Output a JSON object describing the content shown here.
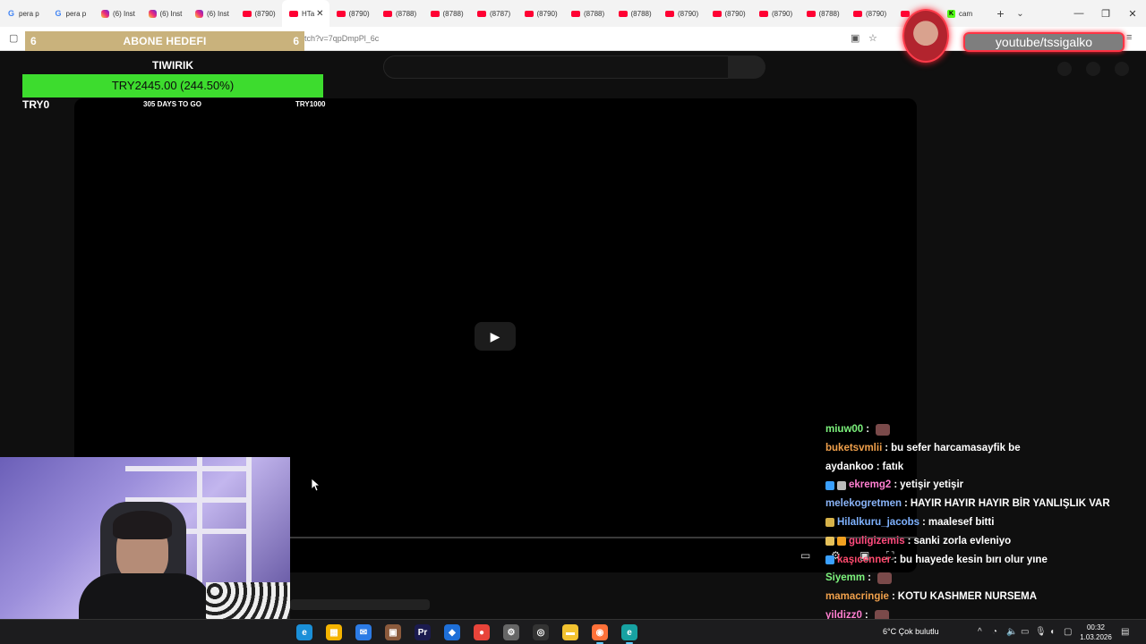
{
  "browser": {
    "tabs": [
      {
        "label": "pera p",
        "favicon": "google-icon"
      },
      {
        "label": "pera p",
        "favicon": "google-icon"
      },
      {
        "label": "(6) Inst",
        "favicon": "instagram-icon"
      },
      {
        "label": "(6) Inst",
        "favicon": "instagram-icon"
      },
      {
        "label": "(6) Inst",
        "favicon": "instagram-icon"
      },
      {
        "label": "(8790)",
        "favicon": "youtube-icon"
      },
      {
        "label": "HTa",
        "favicon": "youtube-icon",
        "active": true
      },
      {
        "label": "(8790)",
        "favicon": "youtube-icon"
      },
      {
        "label": "(8788)",
        "favicon": "youtube-icon"
      },
      {
        "label": "(8788)",
        "favicon": "youtube-icon"
      },
      {
        "label": "(8787)",
        "favicon": "youtube-icon"
      },
      {
        "label": "(8790)",
        "favicon": "youtube-icon"
      },
      {
        "label": "(8788)",
        "favicon": "youtube-icon"
      },
      {
        "label": "(8788)",
        "favicon": "youtube-icon"
      },
      {
        "label": "(8790)",
        "favicon": "youtube-icon"
      },
      {
        "label": "(8790)",
        "favicon": "youtube-icon"
      },
      {
        "label": "(8790)",
        "favicon": "youtube-icon"
      },
      {
        "label": "(8788)",
        "favicon": "youtube-icon"
      },
      {
        "label": "(8790)",
        "favicon": "youtube-icon"
      },
      {
        "label": "",
        "favicon": "youtube-icon"
      },
      {
        "label": "cam",
        "favicon": "kick-icon"
      }
    ],
    "url": "tch?v=7qpDmpPl_6c",
    "new_tab": "+",
    "tab_list": "⌄",
    "close_tab": "✕"
  },
  "overlay": {
    "sub_goal": {
      "title": "ABONE HEDEFI",
      "current": "6",
      "target": "6"
    },
    "donation": {
      "title": "TIWIRIK",
      "value_text": "TRY2445.00 (244.50%)",
      "progress": 1.0,
      "min_label": "TRY0",
      "days_label": "305 DAYS TO GO",
      "max_label": "TRY1000"
    },
    "youtube_handle": "youtube/tssigalko"
  },
  "chat": [
    {
      "user": "miuw00",
      "color": "#7cf27c",
      "message": "",
      "badges": [],
      "emote": true
    },
    {
      "user": "buketsvmlii",
      "color": "#f0a04b",
      "message": "bu sefer harcamasayfik be",
      "badges": []
    },
    {
      "user": "aydankoo",
      "color": "#ffffff",
      "message": "fatık",
      "badges": []
    },
    {
      "user": "ekremg2",
      "color": "#ff7fd0",
      "message": "yetişir yetişir",
      "badges": [
        "#3aa0ff",
        "#bbbbbb"
      ]
    },
    {
      "user": "melekogretmen",
      "color": "#8ab4f8",
      "message": "HAYIR HAYIR HAYIR BİR YANLIŞLIK VAR",
      "badges": []
    },
    {
      "user": "Hilalkuru_jacobs",
      "color": "#7fb2ff",
      "message": "maalesef bitti",
      "badges": [
        "#d6b24a"
      ]
    },
    {
      "user": "guligizemis",
      "color": "#ff4b7d",
      "message": "sanki zorla evleniyo",
      "badges": [
        "#e6c15a",
        "#f0a020"
      ]
    },
    {
      "user": "kaşıcenner",
      "color": "#ff4b6e",
      "message": "bu hıayede kesin bırı olur yıne",
      "badges": [
        "#3aa0ff"
      ]
    },
    {
      "user": "Siyemm",
      "color": "#7cf27c",
      "message": "",
      "badges": [],
      "emote": true
    },
    {
      "user": "mamacringie",
      "color": "#f0a04b",
      "message": "KOTU KASHMER NURSEMA",
      "badges": []
    },
    {
      "user": "yildizz0",
      "color": "#ff7fd0",
      "message": "",
      "badges": [],
      "emote": true
    }
  ],
  "taskbar": {
    "apps": [
      {
        "name": "edge-icon",
        "color": "#1a8fd8",
        "glyph": "e"
      },
      {
        "name": "store-icon",
        "color": "#f5b400",
        "glyph": "▦"
      },
      {
        "name": "mail-icon",
        "color": "#2c7be5",
        "glyph": "✉"
      },
      {
        "name": "minecraft-icon",
        "color": "#8b5a3c",
        "glyph": "▣"
      },
      {
        "name": "premiere-icon",
        "color": "#1b1b4f",
        "glyph": "Pr"
      },
      {
        "name": "app-blue-icon",
        "color": "#1e6fd8",
        "glyph": "◆"
      },
      {
        "name": "chrome-icon",
        "color": "#e8443a",
        "glyph": "●"
      },
      {
        "name": "settings-icon",
        "color": "#666666",
        "glyph": "⚙"
      },
      {
        "name": "obs-icon",
        "color": "#333333",
        "glyph": "◎"
      },
      {
        "name": "explorer-icon",
        "color": "#f2c230",
        "glyph": "▬"
      },
      {
        "name": "firefox-icon",
        "color": "#ff7139",
        "glyph": "◉",
        "active": true
      },
      {
        "name": "app-teal-icon",
        "color": "#17a2a2",
        "glyph": "e",
        "active": true
      }
    ],
    "weather": "6°C  Çok bulutlu",
    "time": "00:32",
    "date": "1.03.2026"
  }
}
